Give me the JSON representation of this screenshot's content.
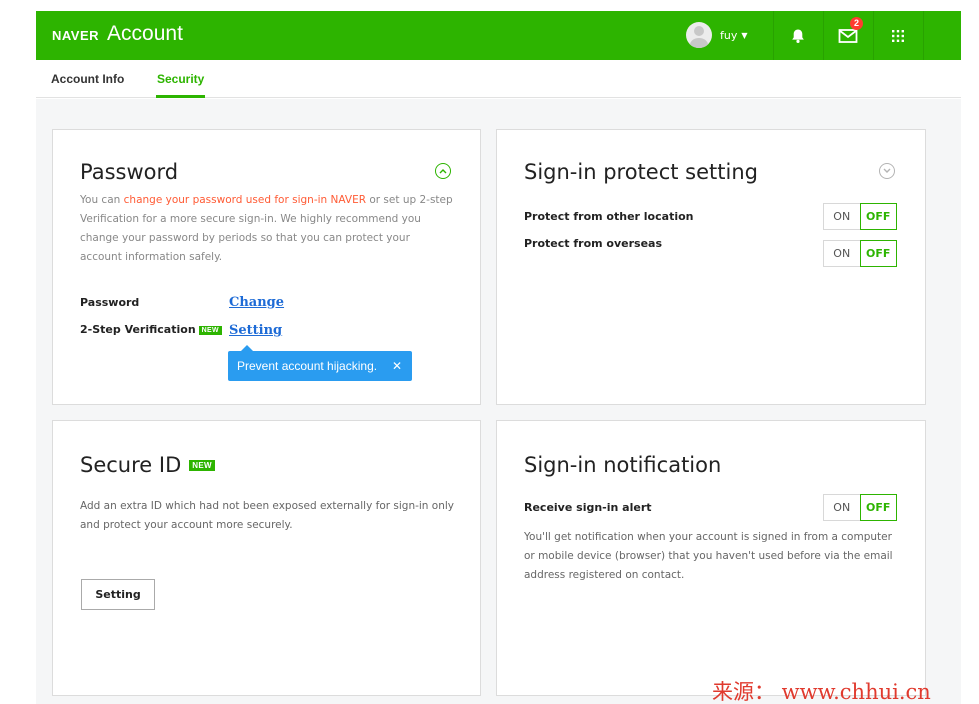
{
  "header": {
    "brand": "NAVER",
    "app_title": "Account",
    "user_name": "fuy",
    "mail_badge_count": "2",
    "accent_color": "#2db400",
    "icons": [
      "bell-icon",
      "mail-icon",
      "apps-grid-icon"
    ]
  },
  "tabs": [
    {
      "label": "Account Info",
      "active": false
    },
    {
      "label": "Security",
      "active": true
    }
  ],
  "password_card": {
    "title": "Password",
    "desc_prefix": "You can ",
    "desc_highlight": "change your password used for sign-in NAVER",
    "desc_suffix": " or set up 2-step Verification for a more secure sign-in. We highly recommend you change your password by periods so that you can protect your account information safely.",
    "password_label": "Password",
    "password_link": "Change",
    "two_step_label": "2-Step Verification",
    "two_step_badge": "NEW",
    "two_step_link": "Setting",
    "tooltip_text": "Prevent account hijacking.",
    "tooltip_close": "✕"
  },
  "signin_protect_card": {
    "title": "Sign-in protect setting",
    "rows": [
      {
        "label": "Protect from other location",
        "on_label": "ON",
        "off_label": "OFF",
        "state": "OFF"
      },
      {
        "label": "Protect from overseas",
        "on_label": "ON",
        "off_label": "OFF",
        "state": "OFF"
      }
    ]
  },
  "secure_id_card": {
    "title": "Secure ID",
    "badge": "NEW",
    "desc": "Add an extra ID which had not been exposed externally for sign-in only and protect your account more securely.",
    "button_label": "Setting"
  },
  "signin_notification_card": {
    "title": "Sign-in notification",
    "alert_label": "Receive sign-in alert",
    "on_label": "ON",
    "off_label": "OFF",
    "state": "OFF",
    "desc": "You'll get notification when your account is signed in from a computer or mobile device (browser) that you haven't used before via the email address registered on contact."
  },
  "watermark": "来源： www.chhui.cn"
}
